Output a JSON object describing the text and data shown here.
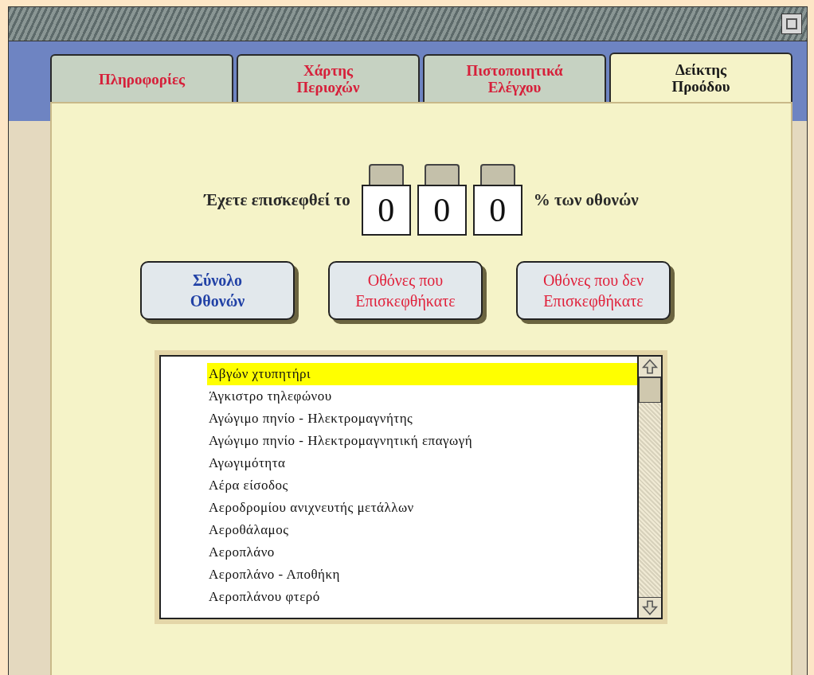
{
  "tabs": [
    {
      "label": "Πληροφορίες",
      "selected": false
    },
    {
      "label": "Χάρτης Περιοχών",
      "selected": false
    },
    {
      "label": "Πιστοποιητικά Ελέγχου",
      "selected": false
    },
    {
      "label": "Δείκτης Προόδου",
      "selected": true
    }
  ],
  "progress": {
    "prefix": "Έχετε επισκεφθεί το",
    "digits": [
      "0",
      "0",
      "0"
    ],
    "suffix": "% των οθονών"
  },
  "filter_buttons": [
    {
      "label": "Σύνολο Οθονών",
      "selected": true
    },
    {
      "label": "Οθόνες που Επισκεφθήκατε",
      "selected": false
    },
    {
      "label": "Οθόνες που δεν Επισκεφθήκατε",
      "selected": false
    }
  ],
  "screens_list": [
    {
      "label": "Αβγών χτυπητήρι",
      "selected": true
    },
    {
      "label": "Άγκιστρο τηλεφώνου",
      "selected": false
    },
    {
      "label": "Αγώγιμο πηνίο - Ηλεκτρομαγνήτης",
      "selected": false
    },
    {
      "label": "Αγώγιμο πηνίο - Ηλεκτρομαγνητική επαγωγή",
      "selected": false
    },
    {
      "label": "Αγωγιμότητα",
      "selected": false
    },
    {
      "label": "Αέρα είσοδος",
      "selected": false
    },
    {
      "label": "Αεροδρομίου ανιχνευτής μετάλλων",
      "selected": false
    },
    {
      "label": "Αεροθάλαμος",
      "selected": false
    },
    {
      "label": "Αεροπλάνο",
      "selected": false
    },
    {
      "label": "Αεροπλάνο - Αποθήκη",
      "selected": false
    },
    {
      "label": "Αεροπλάνου φτερό",
      "selected": false
    }
  ]
}
